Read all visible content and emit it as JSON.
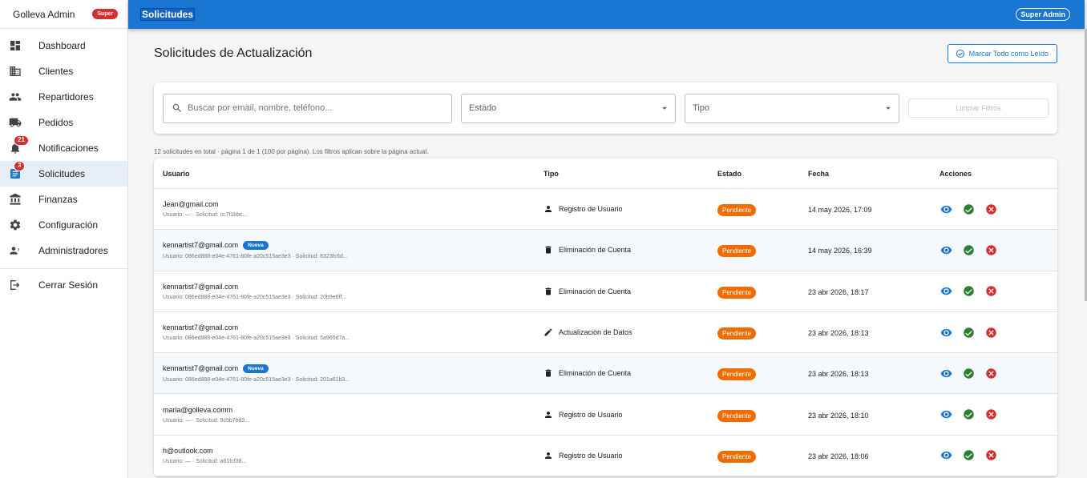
{
  "sidebar": {
    "title": "Golleva Admin",
    "chip": "Super",
    "items": [
      {
        "label": "Dashboard",
        "icon": "dashboard-icon"
      },
      {
        "label": "Clientes",
        "icon": "business-icon"
      },
      {
        "label": "Repartidores",
        "icon": "people-icon"
      },
      {
        "label": "Pedidos",
        "icon": "truck-icon"
      },
      {
        "label": "Notificaciones",
        "icon": "bell-icon",
        "badge": "21"
      },
      {
        "label": "Solicitudes",
        "icon": "document-icon",
        "badge": "3",
        "active": true
      },
      {
        "label": "Finanzas",
        "icon": "bank-icon"
      },
      {
        "label": "Configuración",
        "icon": "gear-icon"
      },
      {
        "label": "Administradores",
        "icon": "admin-people-icon"
      }
    ],
    "logout": "Cerrar Sesión"
  },
  "topbar": {
    "title": "Solicitudes",
    "user_chip": "Super Admin",
    "color": "#1976d2"
  },
  "page": {
    "title": "Solicitudes de Actualización",
    "mark_all_label": "Marcar Todo como Leído"
  },
  "filters": {
    "search_placeholder": "Buscar por email, nombre, teléfono...",
    "estado_label": "Estado",
    "tipo_label": "Tipo",
    "clear_label": "Limpiar Filtros"
  },
  "summary": "12 solicitudes en total · página 1 de 1 (100 por página). Los filtros aplican sobre la página actual.",
  "table": {
    "headers": {
      "usuario": "Usuario",
      "tipo": "Tipo",
      "estado": "Estado",
      "fecha": "Fecha",
      "acciones": "Acciones"
    },
    "new_label": "Nueva",
    "rows": [
      {
        "email": "Jean@gmail.com",
        "nueva": false,
        "meta": "Usuario: — · Solicitud: cc7f1bbc...",
        "tipo": "Registro de Usuario",
        "tipo_icon": "person-icon",
        "estado": "Pendiente",
        "fecha": "14 may 2026, 17:09"
      },
      {
        "email": "kennartist7@gmail.com",
        "nueva": true,
        "meta": "Usuario: 086ed888-e04e-4761-80fe-a20c515ae3e3 · Solicitud: 8323fc6d...",
        "tipo": "Eliminación de Cuenta",
        "tipo_icon": "trash-icon",
        "estado": "Pendiente",
        "fecha": "14 may 2026, 16:39"
      },
      {
        "email": "kennartist7@gmail.com",
        "nueva": false,
        "meta": "Usuario: 086ed888-e04e-4761-80fe-a20c515ae3e3 · Solicitud: 20b9e6ff...",
        "tipo": "Eliminación de Cuenta",
        "tipo_icon": "trash-icon",
        "estado": "Pendiente",
        "fecha": "23 abr 2026, 18:17"
      },
      {
        "email": "kennartist7@gmail.com",
        "nueva": false,
        "meta": "Usuario: 086ed888-e04e-4761-80fe-a20c515ae3e3 · Solicitud: 5a965d7a...",
        "tipo": "Actualización de Datos",
        "tipo_icon": "pencil-icon",
        "estado": "Pendiente",
        "fecha": "23 abr 2026, 18:13"
      },
      {
        "email": "kennartist7@gmail.com",
        "nueva": true,
        "meta": "Usuario: 086ed888-e04e-4761-80fe-a20c515ae3e3 · Solicitud: 201a61b3...",
        "tipo": "Eliminación de Cuenta",
        "tipo_icon": "trash-icon",
        "estado": "Pendiente",
        "fecha": "23 abr 2026, 18:13"
      },
      {
        "email": "maria@golleva.comm",
        "nueva": false,
        "meta": "Usuario: — · Solicitud: 9c5b7bd3...",
        "tipo": "Registro de Usuario",
        "tipo_icon": "person-icon",
        "estado": "Pendiente",
        "fecha": "23 abr 2026, 18:10"
      },
      {
        "email": "h@outlook.com",
        "nueva": false,
        "meta": "Usuario: — · Solicitud: a61fcf38...",
        "tipo": "Registro de Usuario",
        "tipo_icon": "person-icon",
        "estado": "Pendiente",
        "fecha": "23 abr 2026, 18:06"
      }
    ]
  },
  "colors": {
    "pending": "#ef6c00",
    "view": "#1976d2",
    "approve": "#2e7d32",
    "reject": "#d32f2f"
  }
}
